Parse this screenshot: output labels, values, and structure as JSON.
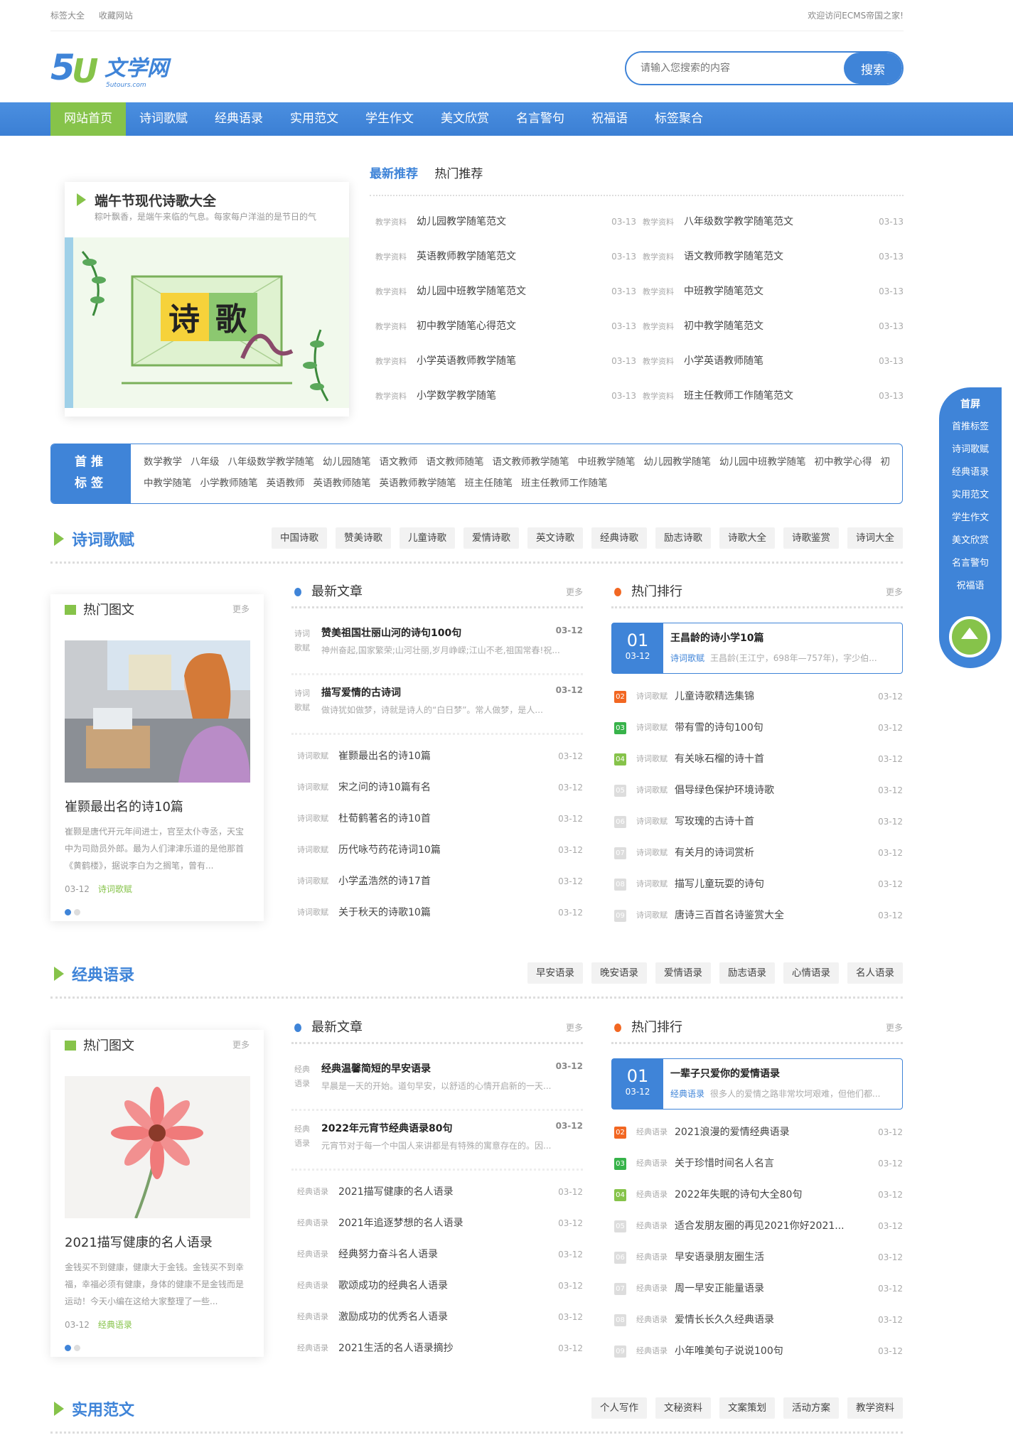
{
  "topbar": {
    "left": [
      "标签大全",
      "收藏网站"
    ],
    "right": "欢迎访问ECMS帝国之家!"
  },
  "logo": {
    "text": "文学网",
    "sub": "5utours.com",
    "mark": "5U"
  },
  "search": {
    "placeholder": "请输入您搜索的内容",
    "button": "搜索"
  },
  "nav": [
    "网站首页",
    "诗词歌赋",
    "经典语录",
    "实用范文",
    "学生作文",
    "美文欣赏",
    "名言警句",
    "祝福语",
    "标签聚合"
  ],
  "featured": {
    "title": "端午节现代诗歌大全",
    "summary": "粽叶飘香，是端午来临的气息。每家每户洋溢的是节日的气",
    "image_text": "诗歌"
  },
  "recommend": {
    "tabs": [
      "最新推荐",
      "热门推荐"
    ],
    "left": [
      {
        "tag": "教学资料",
        "title": "幼儿园教学随笔范文",
        "date": "03-13"
      },
      {
        "tag": "教学资料",
        "title": "英语教师教学随笔范文",
        "date": "03-13"
      },
      {
        "tag": "教学资料",
        "title": "幼儿园中班教学随笔范文",
        "date": "03-13"
      },
      {
        "tag": "教学资料",
        "title": "初中教学随笔心得范文",
        "date": "03-13"
      },
      {
        "tag": "教学资料",
        "title": "小学英语教师教学随笔",
        "date": "03-13"
      },
      {
        "tag": "教学资料",
        "title": "小学数学教学随笔",
        "date": "03-13"
      }
    ],
    "right": [
      {
        "tag": "教学资料",
        "title": "八年级数学教学随笔范文",
        "date": "03-13"
      },
      {
        "tag": "教学资料",
        "title": "语文教师教学随笔范文",
        "date": "03-13"
      },
      {
        "tag": "教学资料",
        "title": "中班教学随笔范文",
        "date": "03-13"
      },
      {
        "tag": "教学资料",
        "title": "初中教学随笔范文",
        "date": "03-13"
      },
      {
        "tag": "教学资料",
        "title": "小学英语教师随笔",
        "date": "03-13"
      },
      {
        "tag": "教学资料",
        "title": "班主任教师工作随笔范文",
        "date": "03-13"
      }
    ]
  },
  "hot_tags": {
    "label1": "首推",
    "label2": "标签",
    "tags": [
      "数学教学",
      "八年级",
      "八年级数学教学随笔",
      "幼儿园随笔",
      "语文教师",
      "语文教师随笔",
      "语文教师教学随笔",
      "中班教学随笔",
      "幼儿园教学随笔",
      "幼儿园中班教学随笔",
      "初中教学心得",
      "初中教学随笔",
      "小学教师随笔",
      "英语教师",
      "英语教师随笔",
      "英语教师教学随笔",
      "班主任随笔",
      "班主任教师工作随笔"
    ]
  },
  "sections": [
    {
      "title": "诗词歌赋",
      "tags": [
        "中国诗歌",
        "赞美诗歌",
        "儿童诗歌",
        "爱情诗歌",
        "英文诗歌",
        "经典诗歌",
        "励志诗歌",
        "诗歌大全",
        "诗歌鉴赏",
        "诗词大全"
      ],
      "hot_pic": {
        "heading": "热门图文",
        "more": "更多",
        "title": "崔颢最出名的诗10篇",
        "desc": "崔颢是唐代开元年间进士，官至太仆寺丞，天宝中为司勋员外郎。最为人们津津乐道的是他那首《黄鹤楼》，据说李白为之搁笔，曾有...",
        "date": "03-12",
        "cat": "诗词歌赋"
      },
      "latest": {
        "heading": "最新文章",
        "more": "更多",
        "big": [
          {
            "cat": "诗词歌赋",
            "title": "赞美祖国壮丽山河的诗句100句",
            "date": "03-12",
            "summary": "神州奋起,国家繁荣;山河壮丽,岁月峥嵘;江山不老,祖国常春!祝..."
          },
          {
            "cat": "诗词歌赋",
            "title": "描写爱情的古诗词",
            "date": "03-12",
            "summary": "做诗犹如做梦，诗就是诗人的“白日梦”。常人做梦，是人..."
          }
        ],
        "items": [
          {
            "tag": "诗词歌赋",
            "title": "崔颢最出名的诗10篇",
            "date": "03-12"
          },
          {
            "tag": "诗词歌赋",
            "title": "宋之问的诗10篇有名",
            "date": "03-12"
          },
          {
            "tag": "诗词歌赋",
            "title": "杜荀鹤著名的诗10首",
            "date": "03-12"
          },
          {
            "tag": "诗词歌赋",
            "title": "历代咏芍药花诗词10篇",
            "date": "03-12"
          },
          {
            "tag": "诗词歌赋",
            "title": "小学孟浩然的诗17首",
            "date": "03-12"
          },
          {
            "tag": "诗词歌赋",
            "title": "关于秋天的诗歌10篇",
            "date": "03-12"
          }
        ]
      },
      "ranking": {
        "heading": "热门排行",
        "more": "更多",
        "top": {
          "num": "01",
          "date": "03-12",
          "title": "王昌龄的诗小学10篇",
          "cat": "诗词歌赋",
          "summary": "王昌龄(王江宁，698年—757年)，字少伯..."
        },
        "items": [
          {
            "rank": "02",
            "tag": "诗词歌赋",
            "title": "儿童诗歌精选集锦",
            "date": "03-12"
          },
          {
            "rank": "03",
            "tag": "诗词歌赋",
            "title": "带有雪的诗句100句",
            "date": "03-12"
          },
          {
            "rank": "04",
            "tag": "诗词歌赋",
            "title": "有关咏石榴的诗十首",
            "date": "03-12"
          },
          {
            "rank": "05",
            "tag": "诗词歌赋",
            "title": "倡导绿色保护环境诗歌",
            "date": "03-12"
          },
          {
            "rank": "06",
            "tag": "诗词歌赋",
            "title": "写玫瑰的古诗十首",
            "date": "03-12"
          },
          {
            "rank": "07",
            "tag": "诗词歌赋",
            "title": "有关月的诗词赏析",
            "date": "03-12"
          },
          {
            "rank": "08",
            "tag": "诗词歌赋",
            "title": "描写儿童玩耍的诗句",
            "date": "03-12"
          },
          {
            "rank": "09",
            "tag": "诗词歌赋",
            "title": "唐诗三百首名诗鉴赏大全",
            "date": "03-12"
          }
        ]
      }
    },
    {
      "title": "经典语录",
      "tags": [
        "早安语录",
        "晚安语录",
        "爱情语录",
        "励志语录",
        "心情语录",
        "名人语录"
      ],
      "hot_pic": {
        "heading": "热门图文",
        "more": "更多",
        "title": "2021描写健康的名人语录",
        "desc": "金钱买不到健康，健康大于金钱。金钱买不到幸福，幸福必须有健康，身体的健康不是金钱而是运动！今天小编在这给大家整理了一些...",
        "date": "03-12",
        "cat": "经典语录"
      },
      "latest": {
        "heading": "最新文章",
        "more": "更多",
        "big": [
          {
            "cat": "经典语录",
            "title": "经典温馨简短的早安语录",
            "date": "03-12",
            "summary": "早晨是一天的开始。道句早安，以舒适的心情开启新的一天..."
          },
          {
            "cat": "经典语录",
            "title": "2022年元宵节经典语录80句",
            "date": "03-12",
            "summary": "元宵节对于每一个中国人来讲都是有特殊的寓意存在的。因..."
          }
        ],
        "items": [
          {
            "tag": "经典语录",
            "title": "2021描写健康的名人语录",
            "date": "03-12"
          },
          {
            "tag": "经典语录",
            "title": "2021年追逐梦想的名人语录",
            "date": "03-12"
          },
          {
            "tag": "经典语录",
            "title": "经典努力奋斗名人语录",
            "date": "03-12"
          },
          {
            "tag": "经典语录",
            "title": "歌颂成功的经典名人语录",
            "date": "03-12"
          },
          {
            "tag": "经典语录",
            "title": "激励成功的优秀名人语录",
            "date": "03-12"
          },
          {
            "tag": "经典语录",
            "title": "2021生活的名人语录摘抄",
            "date": "03-12"
          }
        ]
      },
      "ranking": {
        "heading": "热门排行",
        "more": "更多",
        "top": {
          "num": "01",
          "date": "03-12",
          "title": "一辈子只爱你的爱情语录",
          "cat": "经典语录",
          "summary": "很多人的爱情之路非常坎坷艰难，但他们都..."
        },
        "items": [
          {
            "rank": "02",
            "tag": "经典语录",
            "title": "2021浪漫的爱情经典语录",
            "date": "03-12"
          },
          {
            "rank": "03",
            "tag": "经典语录",
            "title": "关于珍惜时间名人名言",
            "date": "03-12"
          },
          {
            "rank": "04",
            "tag": "经典语录",
            "title": "2022年失眠的诗句大全80句",
            "date": "03-12"
          },
          {
            "rank": "05",
            "tag": "经典语录",
            "title": "适合发朋友圈的再见2021你好2021...",
            "date": "03-12"
          },
          {
            "rank": "06",
            "tag": "经典语录",
            "title": "早安语录朋友圈生活",
            "date": "03-12"
          },
          {
            "rank": "07",
            "tag": "经典语录",
            "title": "周一早安正能量语录",
            "date": "03-12"
          },
          {
            "rank": "08",
            "tag": "经典语录",
            "title": "爱情长长久久经典语录",
            "date": "03-12"
          },
          {
            "rank": "09",
            "tag": "经典语录",
            "title": "小年唯美句子说说100句",
            "date": "03-12"
          }
        ]
      }
    },
    {
      "title": "实用范文",
      "tags": [
        "个人写作",
        "文秘资料",
        "文案策划",
        "活动方案",
        "教学资料"
      ]
    }
  ],
  "float_nav": [
    "首屏",
    "首推标签",
    "诗词歌赋",
    "经典语录",
    "实用范文",
    "学生作文",
    "美文欣赏",
    "名言警句",
    "祝福语"
  ],
  "colors": {
    "primary": "#3f84d8",
    "accent": "#86c34a",
    "rank1": "#f26722",
    "rank2": "#37b34a",
    "rank3": "#86c34a"
  }
}
